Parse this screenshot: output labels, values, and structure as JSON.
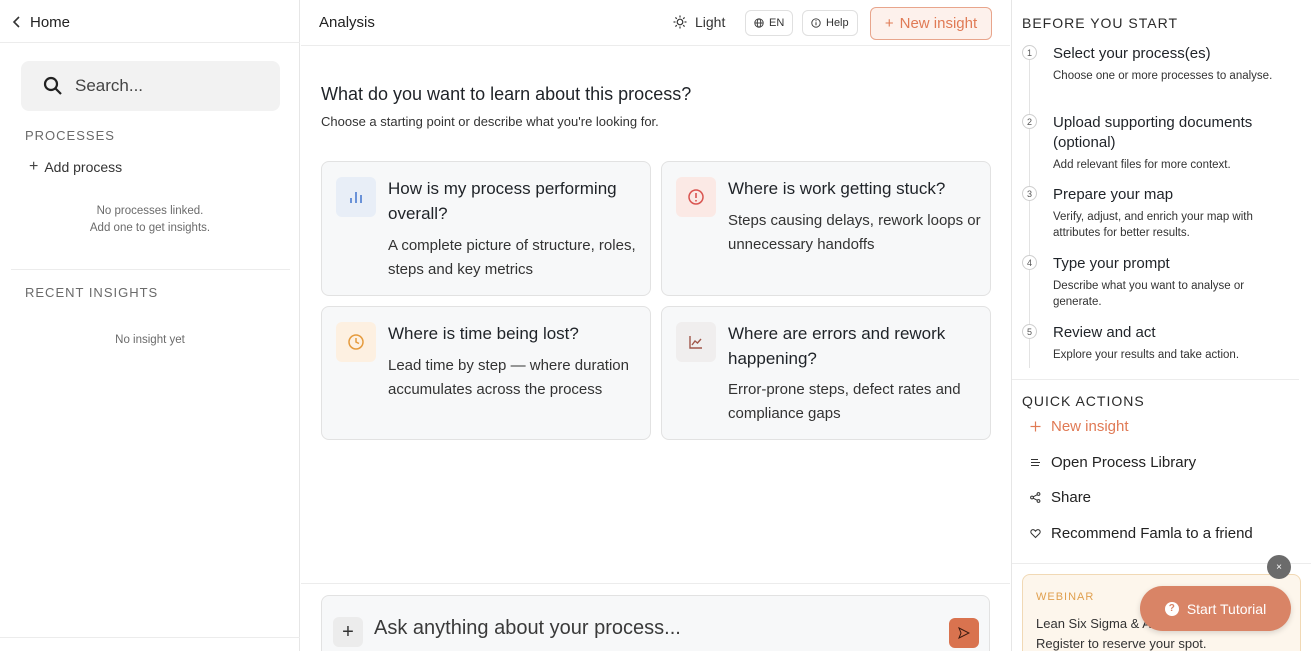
{
  "sidebar": {
    "home_label": "Home",
    "search_placeholder": "Search...",
    "processes_label": "PROCESSES",
    "add_process_label": "Add process",
    "no_processes_line1": "No processes linked.",
    "no_processes_line2": "Add one to get insights.",
    "recent_label": "RECENT INSIGHTS",
    "no_insight": "No insight yet"
  },
  "header": {
    "title": "Analysis",
    "theme_label": "Light",
    "lang_label": "EN",
    "help_label": "Help",
    "new_insight_label": "New insight"
  },
  "main": {
    "question_title": "What do you want to learn about this process?",
    "question_subtitle": "Choose a starting point or describe what you're looking for.",
    "cards": [
      {
        "title": "How is my process performing overall?",
        "desc": "A complete picture of structure, roles, steps and key metrics",
        "icon": "bar-chart-icon",
        "icon_bg": "#e8eef7",
        "icon_color": "#4a7bd0"
      },
      {
        "title": "Where is work getting stuck?",
        "desc": "Steps causing delays, rework loops or unnecessary handoffs",
        "icon": "alert-circle-icon",
        "icon_bg": "#fbe9e5",
        "icon_color": "#d9534f"
      },
      {
        "title": "Where is time being lost?",
        "desc": "Lead time by step — where duration accumulates across the process",
        "icon": "clock-icon",
        "icon_bg": "#fdf0e1",
        "icon_color": "#e59a3c"
      },
      {
        "title": "Where are errors and rework happening?",
        "desc": "Error-prone steps, defect rates and compliance gaps",
        "icon": "trend-chart-icon",
        "icon_bg": "#f0eeee",
        "icon_color": "#a0574a"
      }
    ],
    "composer_placeholder": "Ask anything about your process..."
  },
  "right_panel": {
    "before_label": "BEFORE YOU START",
    "steps": [
      {
        "num": "1",
        "title": "Select your process(es)",
        "desc": "Choose one or more processes to analyse."
      },
      {
        "num": "2",
        "title": "Upload supporting documents (optional)",
        "desc": "Add relevant files for more context."
      },
      {
        "num": "3",
        "title": "Prepare your map",
        "desc": "Verify, adjust, and enrich your map with attributes for better results."
      },
      {
        "num": "4",
        "title": "Type your prompt",
        "desc": "Describe what you want to analyse or generate."
      },
      {
        "num": "5",
        "title": "Review and act",
        "desc": "Explore your results and take action."
      }
    ],
    "quick_label": "QUICK ACTIONS",
    "quick_actions": [
      {
        "label": "New insight"
      },
      {
        "label": "Open Process Library"
      },
      {
        "label": "Share"
      },
      {
        "label": "Recommend Famla to a friend"
      }
    ],
    "webinar": {
      "label": "WEBINAR",
      "title": "Lean Six Sigma & AI",
      "subtitle": "Register to reserve your spot."
    }
  },
  "tutorial": {
    "label": "Start Tutorial",
    "close": "×"
  },
  "colors": {
    "accent": "#e07a55",
    "tutorial_bg": "#d98466"
  }
}
